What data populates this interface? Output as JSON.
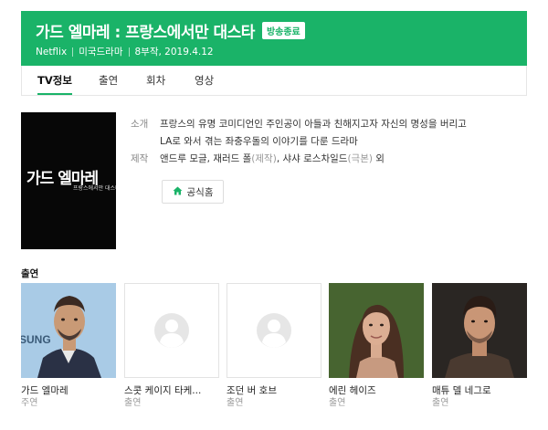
{
  "header": {
    "title": "가드 엘마레 : 프랑스에서만 대스타",
    "badge": "방송종료",
    "channel": "Netflix",
    "genre": "미국드라마",
    "episodes_date": "8부작, 2019.4.12",
    "bg_color": "#1ab368"
  },
  "tabs": [
    {
      "label": "TV정보",
      "active": true
    },
    {
      "label": "출연",
      "active": false
    },
    {
      "label": "회차",
      "active": false
    },
    {
      "label": "영상",
      "active": false
    }
  ],
  "poster": {
    "title_text": "가드 엘마레",
    "subtitle_text": "프랑스에서만 대스타"
  },
  "info": {
    "synopsis_label": "소개",
    "synopsis_line1": "프랑스의 유명 코미디언인 주인공이 아들과 친해지고자 자신의 명성을 버리고",
    "synopsis_line2": "LA로 와서 겪는 좌충우돌의 이야기를 다룬 드라마",
    "production_label": "제작",
    "production_part1": "앤드루 모글, 재러드 폴",
    "production_role1": "(제작)",
    "production_part2": ", 샤샤 로스차일드",
    "production_role2": "(극본)",
    "production_part3": " 외",
    "home_button": "공식홈",
    "home_icon": "home-icon"
  },
  "cast_section": {
    "title": "출연",
    "members": [
      {
        "name": "가드 엘마레",
        "role": "주연",
        "has_photo": true
      },
      {
        "name": "스콧 케이지 타케...",
        "role": "출연",
        "has_photo": false
      },
      {
        "name": "조던 버 호브",
        "role": "출연",
        "has_photo": false
      },
      {
        "name": "에린 헤이즈",
        "role": "출연",
        "has_photo": true
      },
      {
        "name": "매튜 델 네그로",
        "role": "출연",
        "has_photo": true
      }
    ]
  }
}
